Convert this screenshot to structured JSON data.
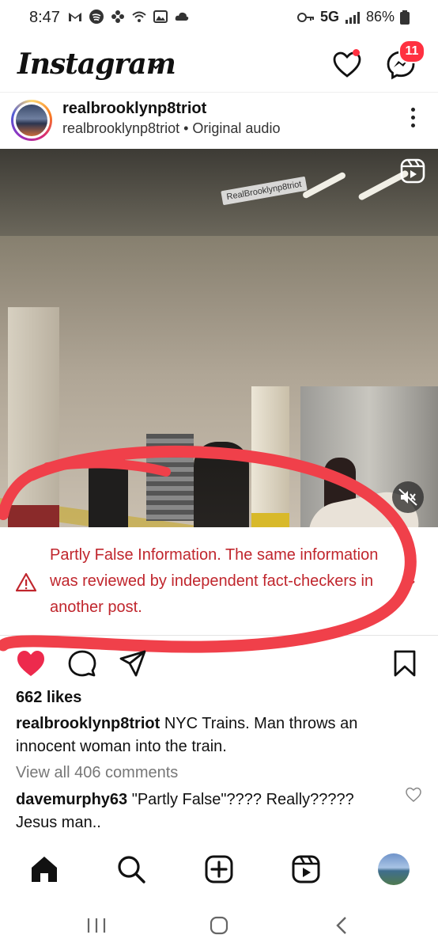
{
  "status_bar": {
    "time": "8:47",
    "network": "5G",
    "battery": "86%"
  },
  "header": {
    "logo": "Instagram",
    "badge_count": "11"
  },
  "post": {
    "username": "realbrooklynp8triot",
    "subline": "realbrooklynp8triot • Original audio",
    "watermark": "RealBrooklynp8triot",
    "factcheck_text": "Partly False Information. The same information was reviewed by independent fact-checkers in another post.",
    "likes": "662 likes",
    "caption_user": "realbrooklynp8triot",
    "caption_text": " NYC Trains. Man throws an innocent woman into the train.",
    "view_all_comments": "View all 406 comments",
    "comment_user": "davemurphy63",
    "comment_text": " \"Partly False\"???? Really????? Jesus man.."
  },
  "colors": {
    "alert_red": "#c0262d",
    "badge_red": "#ff3040",
    "annotation_red": "#f0404a"
  },
  "icons": [
    "heart-icon",
    "messenger-icon",
    "more-icon",
    "reel-icon",
    "mute-icon",
    "warning-icon",
    "comment-icon",
    "share-icon",
    "save-icon",
    "home-icon",
    "search-icon",
    "create-icon",
    "reels-icon"
  ]
}
